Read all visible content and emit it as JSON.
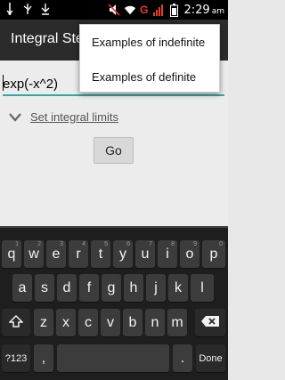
{
  "status_bar": {
    "icons_left": [
      "usb-icon",
      "usb-debug-icon",
      "download-icon"
    ],
    "icons_right": [
      "mute-icon",
      "wifi-icon",
      "signal-icon",
      "battery-icon"
    ],
    "carrier_letter": "G",
    "time": "2:29",
    "ampm": "am"
  },
  "action_bar": {
    "title": "Integral Ste"
  },
  "menu": {
    "items": [
      {
        "label": "Examples of indefinite"
      },
      {
        "label": "Examples of definite"
      }
    ]
  },
  "editor": {
    "expression": "exp(-x^2)",
    "limits_label": "Set integral limits",
    "go_label": "Go"
  },
  "keyboard": {
    "row1": [
      "q",
      "w",
      "e",
      "r",
      "t",
      "y",
      "u",
      "i",
      "o",
      "p"
    ],
    "row1_hints": [
      "1",
      "2",
      "3",
      "4",
      "5",
      "6",
      "7",
      "8",
      "9",
      "0"
    ],
    "row2": [
      "a",
      "s",
      "d",
      "f",
      "g",
      "h",
      "j",
      "k",
      "l"
    ],
    "row3": [
      "z",
      "x",
      "c",
      "v",
      "b",
      "n",
      "m"
    ],
    "symbols_label": "?123",
    "comma_label": ",",
    "period_label": ".",
    "done_label": "Done"
  },
  "colors": {
    "accent": "#33a7a7",
    "carrier": "#e8401f"
  }
}
